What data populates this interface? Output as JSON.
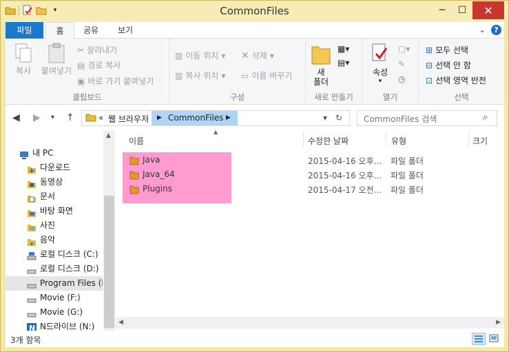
{
  "window": {
    "title": "CommonFiles"
  },
  "ribbon_tabs": {
    "file": "파일",
    "home": "홈",
    "share": "공유",
    "view": "보기"
  },
  "clipboard": {
    "copy": "복사",
    "paste": "붙여넣기",
    "cut": "잘라내기",
    "copy_path": "경로 복사",
    "paste_shortcut": "바로 가기 붙여넣기",
    "label": "클립보드"
  },
  "organize": {
    "move_to": "이동 위치",
    "copy_to": "복사 위치",
    "delete": "삭제",
    "rename": "이름 바꾸기",
    "label": "구성"
  },
  "new": {
    "new_folder": "새\n폴더",
    "label": "새로 만들기"
  },
  "open": {
    "properties": "속성",
    "label": "열기"
  },
  "select": {
    "select_all": "모두 선택",
    "select_none": "선택 안 함",
    "invert": "선택 영역 반전",
    "label": "선택"
  },
  "address": {
    "prefix": "«",
    "parent": "웹 브라우저",
    "current": "CommonFiles"
  },
  "search": {
    "placeholder": "CommonFiles 검색"
  },
  "nav_tree": [
    {
      "label": "내 PC",
      "icon": "pc-icon"
    },
    {
      "label": "다운로드",
      "icon": "downloads-icon"
    },
    {
      "label": "동영상",
      "icon": "videos-icon"
    },
    {
      "label": "문서",
      "icon": "documents-icon"
    },
    {
      "label": "바탕 화면",
      "icon": "desktop-icon"
    },
    {
      "label": "사진",
      "icon": "pictures-icon"
    },
    {
      "label": "음악",
      "icon": "music-icon"
    },
    {
      "label": "로컬 디스크 (C:)",
      "icon": "os-drive-icon"
    },
    {
      "label": "로컬 디스크 (D:)",
      "icon": "drive-icon"
    },
    {
      "label": "Program Files (E:)",
      "icon": "drive-icon"
    },
    {
      "label": "Movie (F:)",
      "icon": "drive-icon"
    },
    {
      "label": "Movie (G:)",
      "icon": "drive-icon"
    },
    {
      "label": "N드라이브 (N:)",
      "icon": "ndrive-icon"
    }
  ],
  "columns": {
    "name": "이름",
    "date": "수정한 날짜",
    "type": "유형",
    "size": "크기"
  },
  "files": [
    {
      "name": "Java",
      "date": "2015-04-16 오후...",
      "type": "파일 폴더"
    },
    {
      "name": "Java_64",
      "date": "2015-04-16 오후...",
      "type": "파일 폴더"
    },
    {
      "name": "Plugins",
      "date": "2015-04-17 오전...",
      "type": "파일 폴더"
    }
  ],
  "status": {
    "count": "3개 항목"
  },
  "colors": {
    "accent": "#1979ca",
    "title_bar": "#f7ecb4",
    "highlight": "#ff9bd0",
    "close": "#c7372e"
  }
}
